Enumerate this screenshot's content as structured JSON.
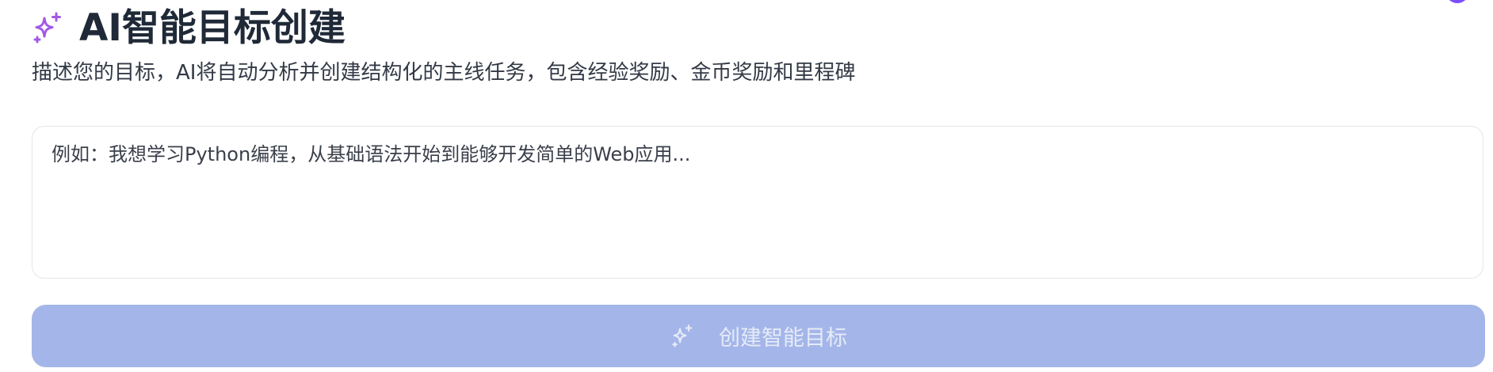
{
  "header": {
    "icon": "sparkles-icon",
    "title": "AI智能目标创建",
    "subtitle": "描述您的目标，AI将自动分析并创建结构化的主线任务，包含经验奖励、金币奖励和里程碑"
  },
  "goal_input": {
    "placeholder": "例如：我想学习Python编程，从基础语法开始到能够开发简单的Web应用...",
    "value": ""
  },
  "create_button": {
    "icon": "sparkles-icon",
    "label": "创建智能目标",
    "disabled": true
  },
  "colors": {
    "accent_purple": "#a259e6",
    "button_bg_disabled": "#a4b6e9",
    "button_text_disabled": "#e6ebf8",
    "title_text": "#1f2937",
    "body_text": "#333a46",
    "border": "#e3e6eb"
  }
}
